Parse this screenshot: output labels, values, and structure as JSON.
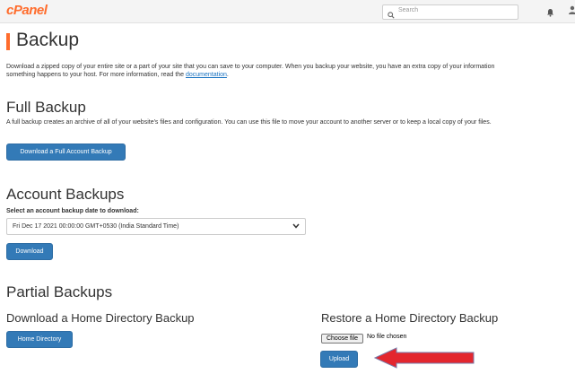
{
  "header": {
    "logo": "cPanel",
    "search_placeholder": "Search"
  },
  "page": {
    "title": "Backup",
    "intro_line1": "Download a zipped copy of your entire site or a part of your site that you can save to your computer. When you backup your website, you have an extra copy of your information",
    "intro_line2_prefix": "something happens to your host. For more information, read the ",
    "intro_link": "documentation",
    "intro_line2_suffix": "."
  },
  "full_backup": {
    "heading": "Full Backup",
    "description": "A full backup creates an archive of all of your website's files and configuration. You can use this file to move your account to another server or to keep a local copy of your files.",
    "button": "Download a Full Account Backup"
  },
  "account_backups": {
    "heading": "Account Backups",
    "select_label": "Select an account backup date to download:",
    "selected_date": "Fri Dec 17 2021 00:00:00 GMT+0530 (India Standard Time)",
    "download_button": "Download"
  },
  "partial_backups": {
    "heading": "Partial Backups",
    "download_home": {
      "heading": "Download a Home Directory Backup",
      "button": "Home Directory"
    },
    "restore_home": {
      "heading": "Restore a Home Directory Backup",
      "choose_file": "Choose file",
      "file_status": "No file chosen",
      "upload_button": "Upload"
    }
  },
  "colors": {
    "brand": "#ff6c2c",
    "primary_button": "#337ab7",
    "annotation_arrow": "#e3262e"
  },
  "icons": [
    "search-icon",
    "bell-icon",
    "chevron-down-icon",
    "arrow-left-annotation"
  ]
}
